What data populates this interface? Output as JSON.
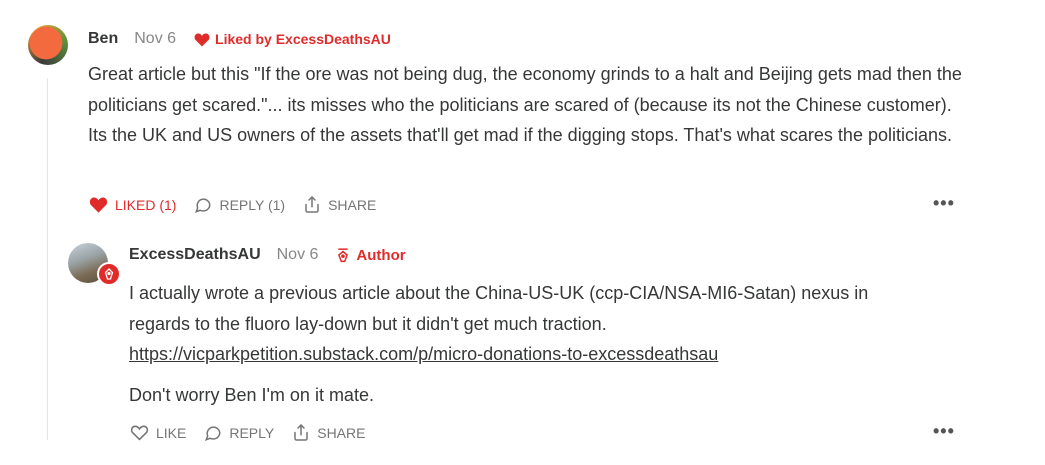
{
  "comment": {
    "author": "Ben",
    "date": "Nov 6",
    "liked_by": "Liked by ExcessDeathsAU",
    "body": "Great article but this \"If the ore was not being dug, the economy grinds to a halt and Beijing gets mad then the politicians get scared.\"... its misses who the politicians are scared of (because its not the Chinese customer). Its the UK and US owners of the assets that'll get mad if the digging stops. That's what scares the politicians.",
    "actions": {
      "like": "LIKED (1)",
      "reply": "REPLY (1)",
      "share": "SHARE"
    },
    "more": "•••"
  },
  "reply": {
    "author": "ExcessDeathsAU",
    "date": "Nov 6",
    "badge": "Author",
    "paragraph1": "I actually wrote a previous article about the China-US-UK (ccp-CIA/NSA-MI6-Satan) nexus in regards to the fluoro lay-down but it didn't get much traction.",
    "link": "https://vicparkpetition.substack.com/p/micro-donations-to-excessdeathsau",
    "paragraph2": "Don't worry Ben I'm on it mate.",
    "actions": {
      "like": "LIKE",
      "reply": "REPLY",
      "share": "SHARE"
    },
    "more": "•••"
  },
  "colors": {
    "accent": "#e02b2b",
    "text": "#363737",
    "muted": "#868787"
  }
}
